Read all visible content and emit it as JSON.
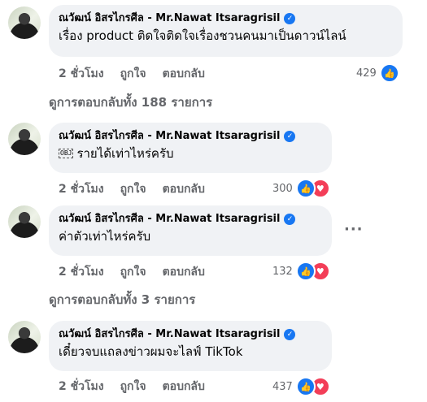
{
  "comments": [
    {
      "author": "ณวัฒน์ อิสรไกรศีล - Mr.Nawat Itsaragrisil",
      "verified_icon": "verified-badge-icon",
      "text": "เรื่อง product ติดใจติดใจเรื่องชวนคนมาเป็นดาวน์ไลน์",
      "time": "2 ชั่วโมง",
      "like_label": "ถูกใจ",
      "reply_label": "ตอบกลับ",
      "reaction_count": "429",
      "reactions": [
        "like"
      ]
    },
    {
      "author": "ณวัฒน์ อิสรไกรศีล - Mr.Nawat Itsaragrisil",
      "verified_icon": "verified-badge-icon",
      "obj_glyph": "OBJ",
      "text": "รายได้เท่าไหร่ครับ",
      "time": "2 ชั่วโมง",
      "like_label": "ถูกใจ",
      "reply_label": "ตอบกลับ",
      "reaction_count": "300",
      "reactions": [
        "like",
        "love"
      ]
    },
    {
      "author": "ณวัฒน์ อิสรไกรศีล - Mr.Nawat Itsaragrisil",
      "verified_icon": "verified-badge-icon",
      "text": "ค่าตัวเท่าไหร่ครับ",
      "time": "2 ชั่วโมง",
      "like_label": "ถูกใจ",
      "reply_label": "ตอบกลับ",
      "reaction_count": "132",
      "reactions": [
        "like",
        "love"
      ],
      "more_label": "···"
    },
    {
      "author": "ณวัฒน์ อิสรไกรศีล - Mr.Nawat Itsaragrisil",
      "verified_icon": "verified-badge-icon",
      "text": "เดี๋ยวจบแถลงข่าวผมจะไลฟ์ TikTok",
      "time": "2 ชั่วโมง",
      "like_label": "ถูกใจ",
      "reply_label": "ตอบกลับ",
      "reaction_count": "437",
      "reactions": [
        "like",
        "love"
      ]
    }
  ],
  "view_replies": [
    "ดูการตอบกลับทั้ง 188 รายการ",
    "ดูการตอบกลับทั้ง 3 รายการ"
  ],
  "colors": {
    "bubble_bg": "#f0f2f5",
    "meta_text": "#65676b",
    "like_blue": "#1877f2",
    "love_red": "#f33e58"
  }
}
